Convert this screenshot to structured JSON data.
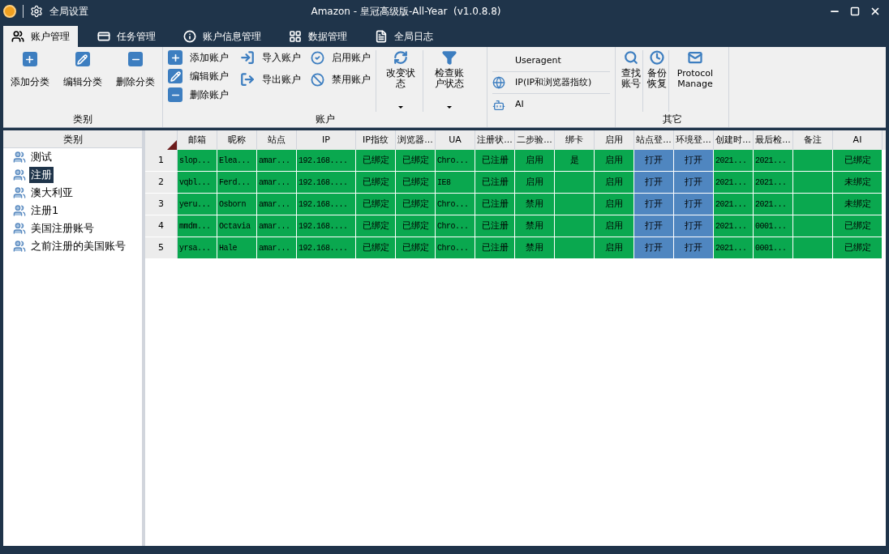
{
  "title_bar": {
    "settings": "全局设置",
    "title": "Amazon - 皇冠高级版-All-Year  (v1.0.8.8)"
  },
  "tabs": [
    {
      "label": "账户管理",
      "selected": true
    },
    {
      "label": "任务管理",
      "selected": false
    },
    {
      "label": "账户信息管理",
      "selected": false
    },
    {
      "label": "数据管理",
      "selected": false
    },
    {
      "label": "全局日志",
      "selected": false
    }
  ],
  "ribbon": {
    "category_group": {
      "label": "类别",
      "buttons": [
        "添加分类",
        "编辑分类",
        "删除分类"
      ]
    },
    "account_group": {
      "label": "账户",
      "column_1": [
        "添加账户",
        "编辑账户",
        "删除账户"
      ],
      "column_2": [
        "导入账户",
        "导出账户"
      ],
      "column_3": [
        "启用账户",
        "禁用账户"
      ],
      "dropdowns": [
        "改变状态",
        "检查账户状态"
      ]
    },
    "settings_list": [
      "Useragent",
      "IP(IP和浏览器指纹)",
      "AI"
    ],
    "other_group": {
      "label": "其它",
      "buttons": [
        "查找账号",
        "备份恢复",
        "Protocol Manage"
      ]
    }
  },
  "sidebar": {
    "header": "类别",
    "items": [
      {
        "label": "测试",
        "selected": false
      },
      {
        "label": "注册",
        "selected": true
      },
      {
        "label": "澳大利亚",
        "selected": false
      },
      {
        "label": "注册1",
        "selected": false
      },
      {
        "label": "美国注册账号",
        "selected": false
      },
      {
        "label": "之前注册的美国账号",
        "selected": false
      }
    ]
  },
  "table": {
    "columns": [
      {
        "label": "邮箱",
        "kind": "mono"
      },
      {
        "label": "昵称",
        "kind": "mono"
      },
      {
        "label": "站点",
        "kind": "mono"
      },
      {
        "label": "IP",
        "kind": "mono"
      },
      {
        "label": "IP指纹",
        "kind": "text"
      },
      {
        "label": "浏览器...",
        "kind": "text"
      },
      {
        "label": "UA",
        "kind": "mono"
      },
      {
        "label": "注册状...",
        "kind": "text"
      },
      {
        "label": "二步验...",
        "kind": "text"
      },
      {
        "label": "绑卡",
        "kind": "text"
      },
      {
        "label": "启用",
        "kind": "text"
      },
      {
        "label": "站点登...",
        "kind": "button"
      },
      {
        "label": "环境登...",
        "kind": "button"
      },
      {
        "label": "创建时...",
        "kind": "mono"
      },
      {
        "label": "最后检...",
        "kind": "mono"
      },
      {
        "label": "备注",
        "kind": "text"
      },
      {
        "label": "AI",
        "kind": "text"
      }
    ],
    "rows": [
      {
        "number": "1",
        "cells": [
          "slop...",
          "Elea...",
          "amar...",
          "192.168....",
          "已绑定",
          "已绑定",
          "Chro...",
          "已注册",
          "启用",
          "是",
          "启用",
          "打开",
          "打开",
          "2021...",
          "2021...",
          "",
          "已绑定"
        ]
      },
      {
        "number": "2",
        "cells": [
          "vqbl...",
          "Ferd...",
          "amar...",
          "192.168....",
          "已绑定",
          "已绑定",
          "IE8",
          "已注册",
          "启用",
          "",
          "启用",
          "打开",
          "打开",
          "2021...",
          "2021...",
          "",
          "未绑定"
        ]
      },
      {
        "number": "3",
        "cells": [
          "yeru...",
          "Osborn",
          "amar...",
          "192.168....",
          "已绑定",
          "已绑定",
          "Chro...",
          "已注册",
          "禁用",
          "",
          "启用",
          "打开",
          "打开",
          "2021...",
          "2021...",
          "",
          "未绑定"
        ]
      },
      {
        "number": "4",
        "cells": [
          "mmdm...",
          "Octavia",
          "amar...",
          "192.168....",
          "已绑定",
          "已绑定",
          "Chro...",
          "已注册",
          "禁用",
          "",
          "启用",
          "打开",
          "打开",
          "2021...",
          "0001...",
          "",
          "已绑定"
        ]
      },
      {
        "number": "5",
        "cells": [
          "yrsa...",
          "Hale",
          "amar...",
          "192.168....",
          "已绑定",
          "已绑定",
          "Chro...",
          "已注册",
          "禁用",
          "",
          "启用",
          "打开",
          "打开",
          "2021...",
          "0001...",
          "",
          "已绑定"
        ]
      }
    ]
  }
}
